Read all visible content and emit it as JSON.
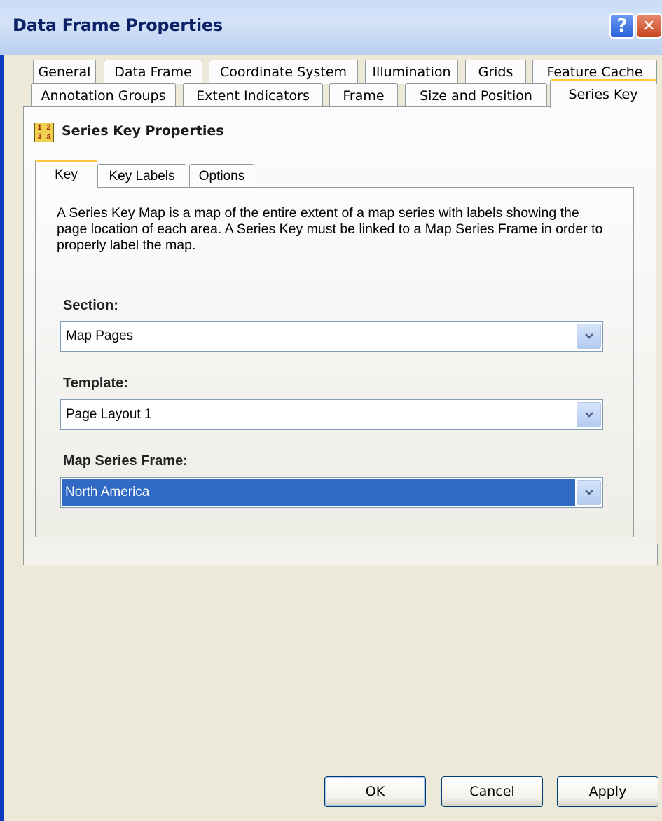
{
  "window": {
    "title": "Data Frame Properties",
    "help_glyph": "?",
    "close_glyph": "✕"
  },
  "tabs_row1": [
    "General",
    "Data Frame",
    "Coordinate System",
    "Illumination",
    "Grids",
    "Feature Cache"
  ],
  "tabs_row2": [
    "Annotation Groups",
    "Extent Indicators",
    "Frame",
    "Size and Position",
    "Series Key"
  ],
  "selected_tab": "Series Key",
  "header": {
    "icon": "series-key-icon",
    "icon_glyphs": [
      "1",
      "2",
      "3",
      "a"
    ],
    "title": "Series Key Properties"
  },
  "inner_tabs": [
    "Key",
    "Key Labels",
    "Options"
  ],
  "selected_inner_tab": "Key",
  "description": "A Series Key Map is a map of the entire extent of a map series with labels showing the page location of each area.  A Series Key must be linked to a Map Series Frame in order to properly label the map.",
  "fields": {
    "section": {
      "label": "Section:",
      "value": "Map Pages"
    },
    "template": {
      "label": "Template:",
      "value": "Page Layout 1"
    },
    "map_series_frame": {
      "label": "Map Series Frame:",
      "value": "North America"
    }
  },
  "buttons": {
    "ok": "OK",
    "cancel": "Cancel",
    "apply": "Apply"
  },
  "colors": {
    "selection": "#316ac5",
    "tab_highlight": "#ffc83c",
    "title_text": "#0b2266"
  }
}
